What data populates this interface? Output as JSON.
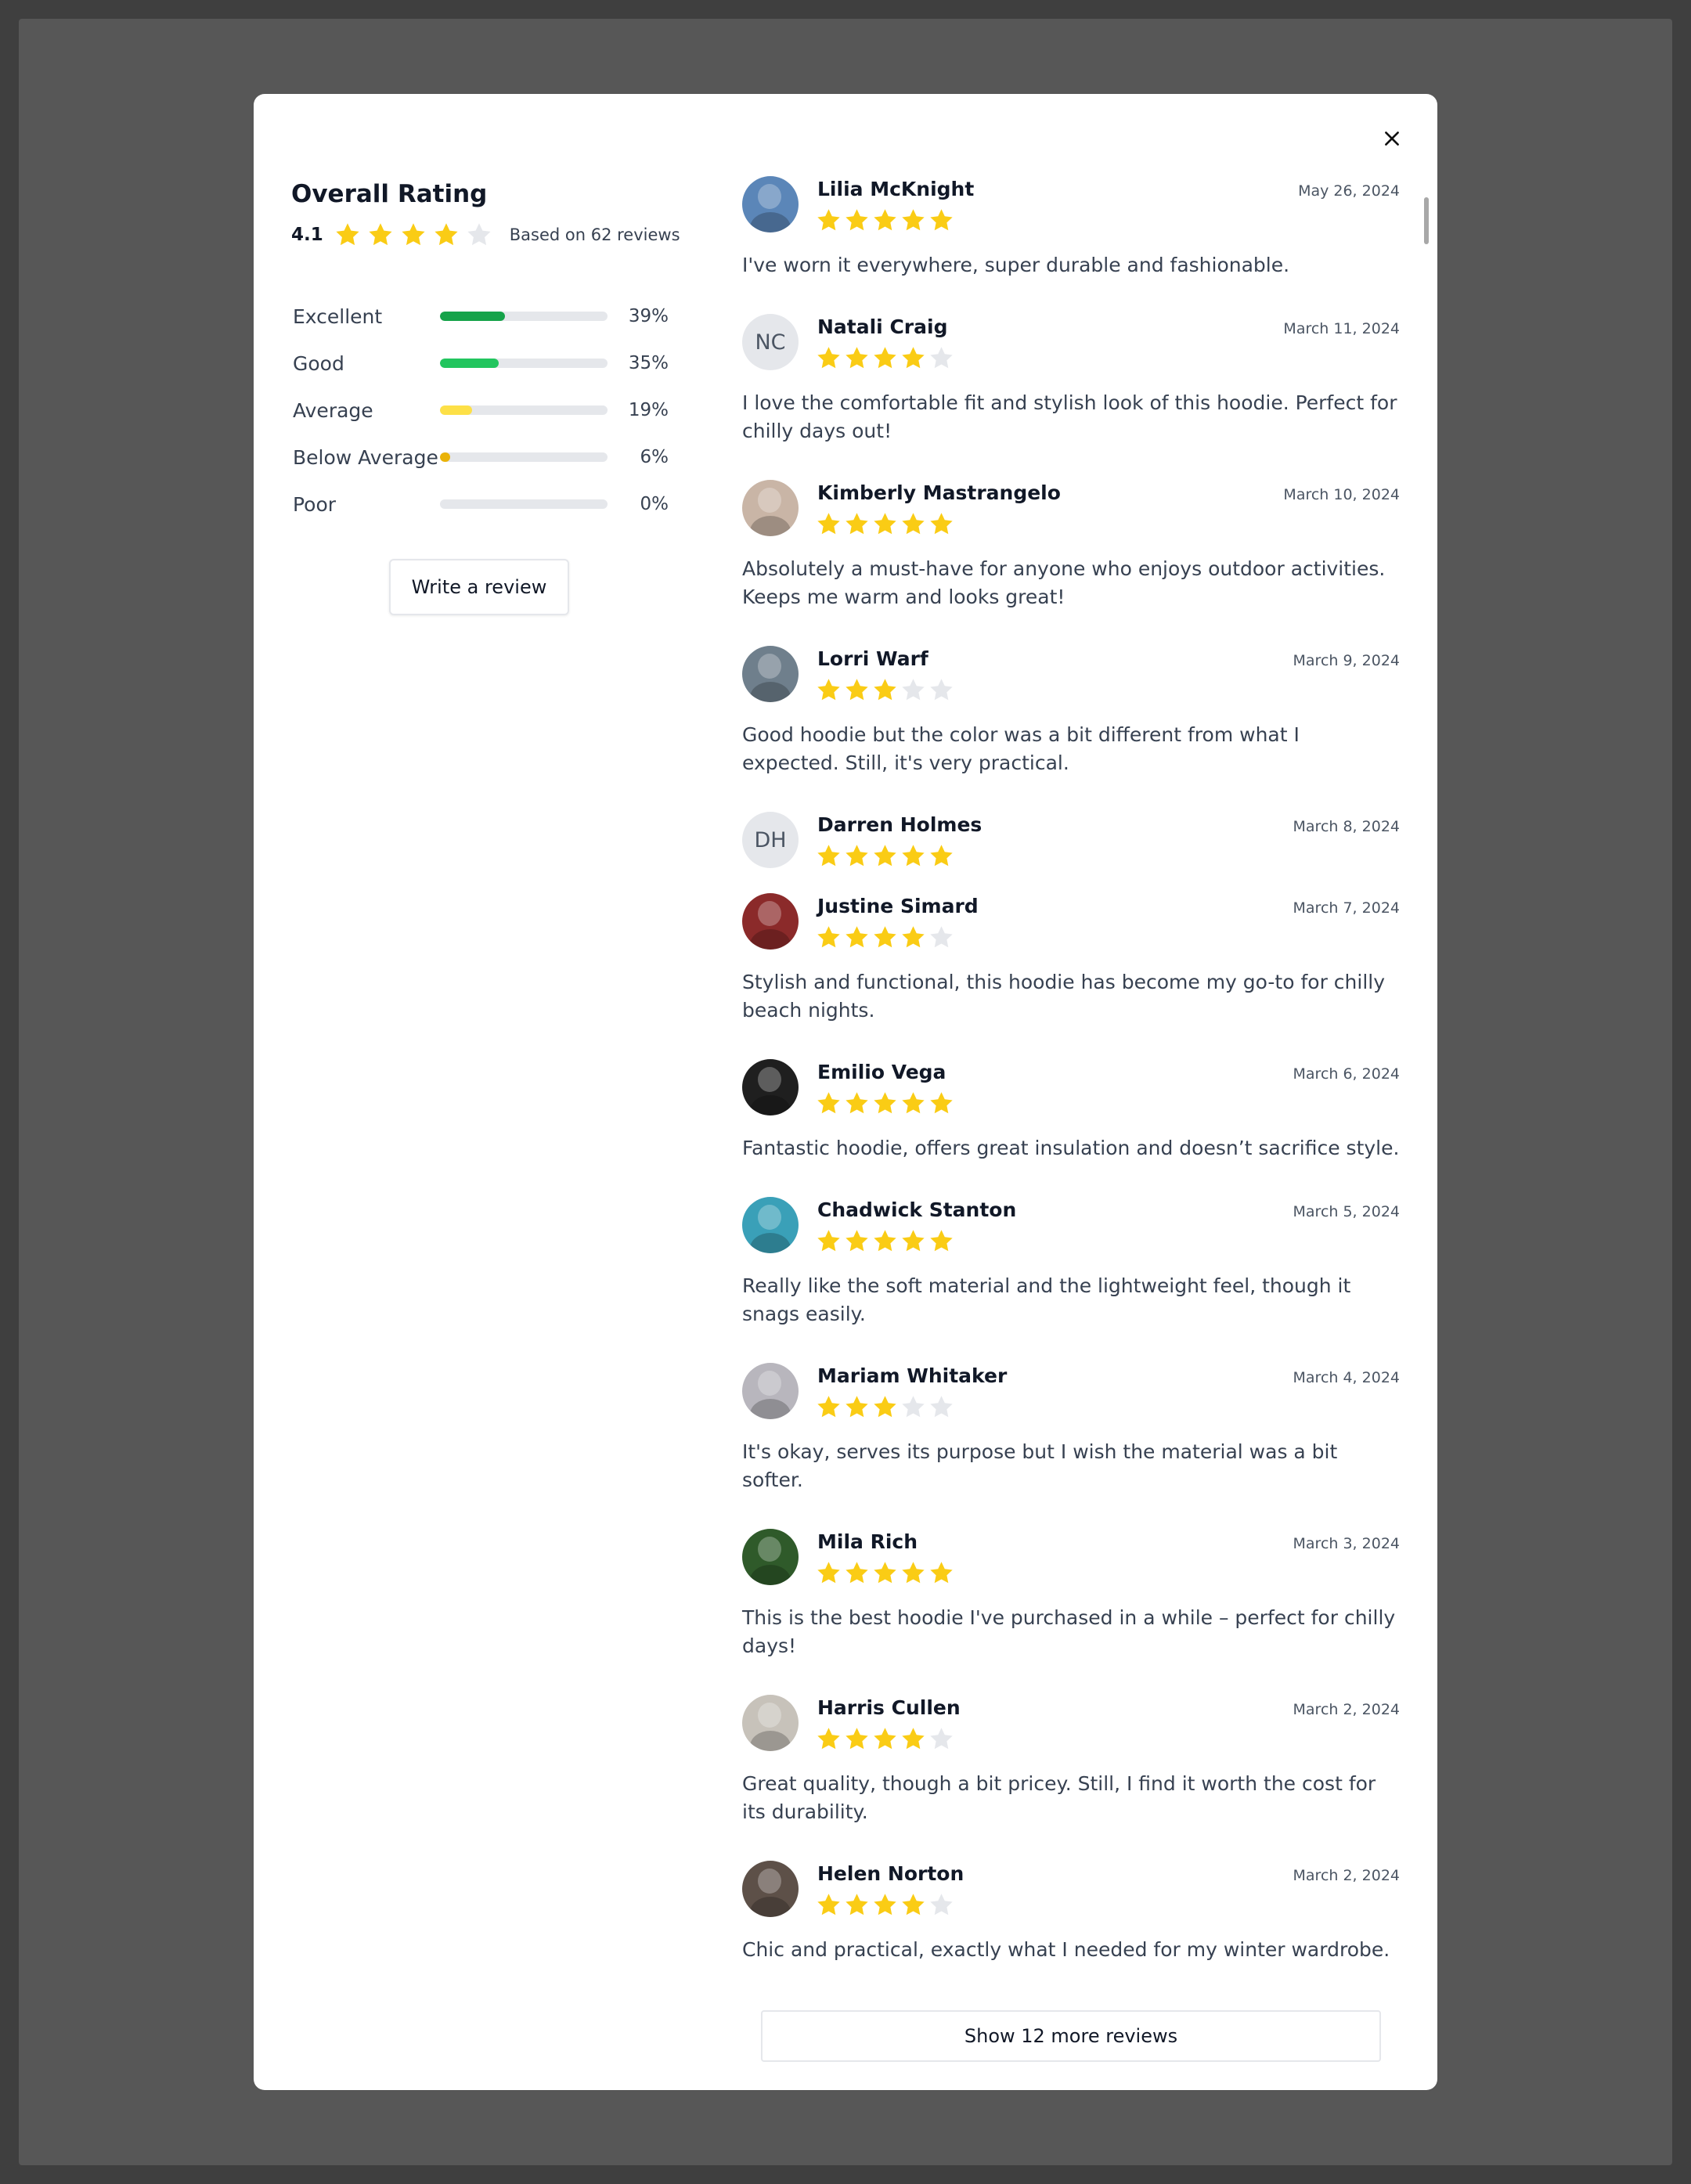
{
  "dialog": {
    "close_icon": "close-icon",
    "summary": {
      "title": "Overall Rating",
      "score": "4.1",
      "score_value": 4.1,
      "stars_filled": 4,
      "based_on": "Based on 62 reviews",
      "write_review_label": "Write a review"
    },
    "breakdown": [
      {
        "label": "Excellent",
        "pct_text": "39%",
        "value": 39,
        "color": "#16a34a"
      },
      {
        "label": "Good",
        "pct_text": "35%",
        "value": 35,
        "color": "#22c55e"
      },
      {
        "label": "Average",
        "pct_text": "19%",
        "value": 19,
        "color": "#fde047"
      },
      {
        "label": "Below Average",
        "pct_text": "6%",
        "value": 6,
        "color": "#eab308"
      },
      {
        "label": "Poor",
        "pct_text": "0%",
        "value": 0,
        "color": "#dc2626"
      }
    ],
    "reviews": [
      {
        "name": "Lilia McKnight",
        "date": "May 26, 2024",
        "rating": 5,
        "text": "I've worn it everywhere, super durable and fashionable.",
        "avatar": "photo",
        "avatar_color": "#5b86b8"
      },
      {
        "name": "Natali Craig",
        "date": "March 11, 2024",
        "rating": 4,
        "text": "I love the comfortable fit and stylish look of this hoodie. Perfect for chilly days out!",
        "avatar": "initials",
        "initials": "NC"
      },
      {
        "name": "Kimberly Mastrangelo",
        "date": "March 10, 2024",
        "rating": 5,
        "text": "Absolutely a must-have for anyone who enjoys outdoor activities. Keeps me warm and looks great!",
        "avatar": "photo",
        "avatar_color": "#c9b5a6"
      },
      {
        "name": "Lorri Warf",
        "date": "March 9, 2024",
        "rating": 3,
        "text": "Good hoodie but the color was a bit different from what I expected. Still, it's very practical.",
        "avatar": "photo",
        "avatar_color": "#6f7f8c"
      },
      {
        "name": "Darren Holmes",
        "date": "March 8, 2024",
        "rating": 5,
        "text": "",
        "avatar": "initials",
        "initials": "DH"
      },
      {
        "name": "Justine Simard",
        "date": "March 7, 2024",
        "rating": 4,
        "text": "Stylish and functional, this hoodie has become my go-to for chilly beach nights.",
        "avatar": "photo",
        "avatar_color": "#8b2a2a"
      },
      {
        "name": "Emilio Vega",
        "date": "March 6, 2024",
        "rating": 5,
        "text": "Fantastic hoodie, offers great insulation and doesn’t sacrifice style.",
        "avatar": "photo",
        "avatar_color": "#1f1f1f"
      },
      {
        "name": "Chadwick Stanton",
        "date": "March 5, 2024",
        "rating": 5,
        "text": "Really like the soft material and the lightweight feel, though it snags easily.",
        "avatar": "photo",
        "avatar_color": "#3aa0b8"
      },
      {
        "name": "Mariam Whitaker",
        "date": "March 4, 2024",
        "rating": 3,
        "text": "It's okay, serves its purpose but I wish the material was a bit softer.",
        "avatar": "photo",
        "avatar_color": "#b8b6bd"
      },
      {
        "name": "Mila Rich",
        "date": "March 3, 2024",
        "rating": 5,
        "text": "This is the best hoodie I've purchased in a while – perfect for chilly days!",
        "avatar": "photo",
        "avatar_color": "#2f5a2a"
      },
      {
        "name": "Harris Cullen",
        "date": "March 2, 2024",
        "rating": 4,
        "text": "Great quality, though a bit pricey. Still, I find it worth the cost for its durability.",
        "avatar": "photo",
        "avatar_color": "#c7c2ba"
      },
      {
        "name": "Helen Norton",
        "date": "March 2, 2024",
        "rating": 4,
        "text": "Chic and practical, exactly what I needed for my winter wardrobe.",
        "avatar": "photo",
        "avatar_color": "#5d5048"
      }
    ],
    "show_more_label": "Show 12 more reviews"
  }
}
